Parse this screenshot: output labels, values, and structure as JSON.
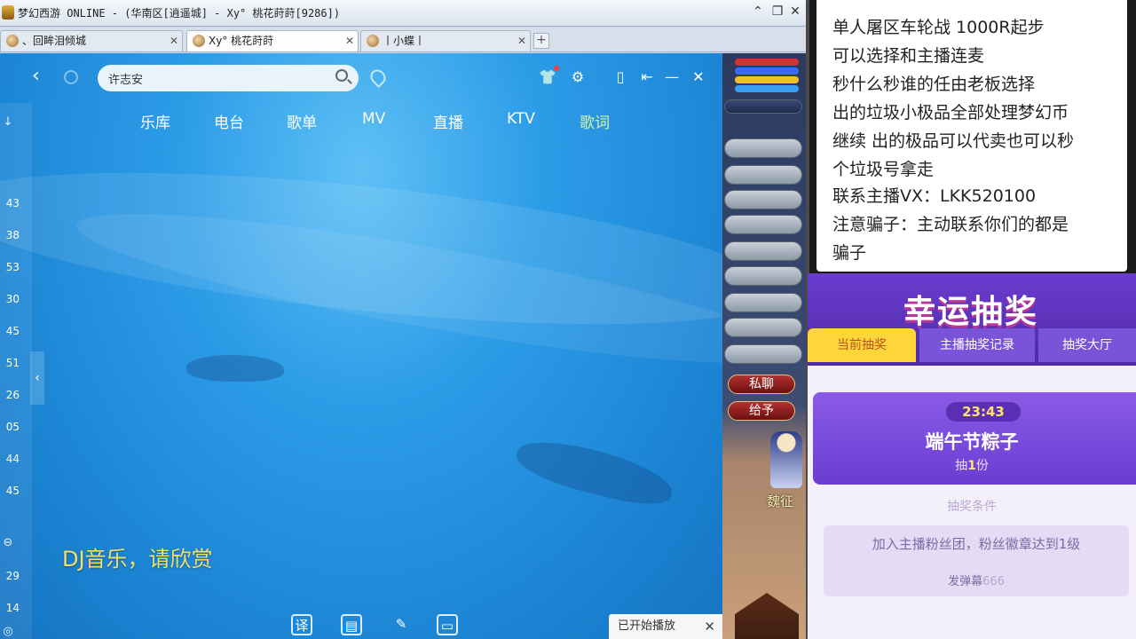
{
  "window": {
    "title": "梦幻西游 ONLINE - (华南区[逍遥城] - Xy° 桃花莳莳[9286])",
    "minimize": "⌃",
    "restore": "❐",
    "close": "✕"
  },
  "tabs": [
    {
      "label": "、回眸泪倾城",
      "close": "✕"
    },
    {
      "label": "Xy° 桃花莳莳",
      "close": "✕"
    },
    {
      "label": "丨小蝶丨",
      "close": "✕"
    }
  ],
  "tab_add": "+",
  "game": {
    "buttons": [
      "私聊",
      "给予"
    ],
    "npc_name": "魏征"
  },
  "player": {
    "search": {
      "value": "许志安",
      "placeholder": ""
    },
    "nav_tabs": [
      "乐库",
      "电台",
      "歌单",
      "MV",
      "直播",
      "KTV",
      "歌词"
    ],
    "active_tab": "歌词",
    "side_numbers": [
      "43",
      "38",
      "53",
      "30",
      "45",
      "51",
      "26",
      "05",
      "44",
      "45",
      "29",
      "14"
    ],
    "lyric": "DJ音乐，请欣赏",
    "bottom_icons": [
      "译",
      "▤",
      "✎",
      "▭"
    ],
    "toast": {
      "text": "已开始播放",
      "close": "✕"
    },
    "window_controls": {
      "skin": "👕",
      "settings": "⚙",
      "mini": "▯",
      "dock": "⇤",
      "minimize": "—",
      "close": "✕"
    }
  },
  "notice": {
    "lines": [
      "单人屠区车轮战 1000R起步",
      "可以选择和主播连麦",
      "秒什么秒谁的任由老板选择",
      "出的垃圾小极品全部处理梦幻币",
      "继续 出的极品可以代卖也可以秒",
      "个垃圾号拿走",
      "联系主播VX：LKK520100",
      " 注意骗子：主动联系你们的都是",
      "骗子"
    ]
  },
  "lottery": {
    "title": "幸运抽奖",
    "tabs": [
      "当前抽奖",
      "主播抽奖记录",
      "抽奖大厅"
    ],
    "timer": "23:43",
    "prize_name": "端午节粽子",
    "prize_count_prefix": "抽",
    "prize_count_num": "1",
    "prize_count_suffix": "份",
    "cond_title": "抽奖条件",
    "cond_text": "加入主播粉丝团，粉丝徽章达到1级",
    "cond_sub": "发弹幕",
    "cond_sub_num": "666"
  },
  "colors": {
    "player_bg": "#2d9de8",
    "lyric": "#f3e06a",
    "lottery_purple": "#6b3ccf",
    "lottery_tab_active": "#ffd63a"
  }
}
